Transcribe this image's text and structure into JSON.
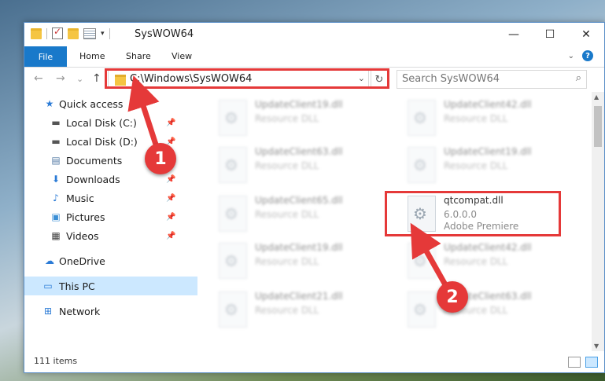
{
  "window": {
    "title": "SysWOW64",
    "controls": {
      "minimize": "—",
      "maximize": "☐",
      "close": "✕"
    }
  },
  "ribbon": {
    "file": "File",
    "tabs": [
      "Home",
      "Share",
      "View"
    ]
  },
  "nav": {
    "back": "←",
    "forward": "→",
    "recent": "⌄",
    "up": "↑",
    "address": "C:\\Windows\\SysWOW64",
    "search_placeholder": "Search SysWOW64"
  },
  "sidebar": {
    "items": [
      {
        "label": "Quick access",
        "icon": "star-icon"
      },
      {
        "label": "Local Disk (C:)",
        "icon": "drive-icon",
        "pinned": true
      },
      {
        "label": "Local Disk (D:)",
        "icon": "drive-icon",
        "pinned": true
      },
      {
        "label": "Documents",
        "icon": "documents-icon"
      },
      {
        "label": "Downloads",
        "icon": "downloads-icon",
        "pinned": true
      },
      {
        "label": "Music",
        "icon": "music-icon",
        "pinned": true
      },
      {
        "label": "Pictures",
        "icon": "pictures-icon",
        "pinned": true
      },
      {
        "label": "Videos",
        "icon": "videos-icon",
        "pinned": true
      },
      {
        "label": "OneDrive",
        "icon": "cloud-icon"
      },
      {
        "label": "This PC",
        "icon": "computer-icon",
        "selected": true
      },
      {
        "label": "Network",
        "icon": "network-icon"
      }
    ]
  },
  "files": [
    {
      "name": "UpdateClient19.dll",
      "sub": "Resource DLL"
    },
    {
      "name": "UpdateClient42.dll",
      "sub": "Resource DLL"
    },
    {
      "name": "UpdateClient63.dll",
      "sub": "Resource DLL"
    },
    {
      "name": "UpdateClient19.dll",
      "sub": "Resource DLL"
    },
    {
      "name": "UpdateClient65.dll",
      "sub": "Resource DLL"
    },
    {
      "name": "qtcompat.dll",
      "sub": "6.0.0.0",
      "sub2": "Adobe Premiere"
    },
    {
      "name": "UpdateClient19.dll",
      "sub": "Resource DLL"
    },
    {
      "name": "UpdateClient42.dll",
      "sub": "Resource DLL"
    },
    {
      "name": "UpdateClient21.dll",
      "sub": "Resource DLL"
    },
    {
      "name": "UpdateClient63.dll",
      "sub": "Resource DLL"
    }
  ],
  "status": {
    "count": "111 items"
  },
  "annotations": {
    "step1": "1",
    "step2": "2",
    "color": "#e53939"
  }
}
